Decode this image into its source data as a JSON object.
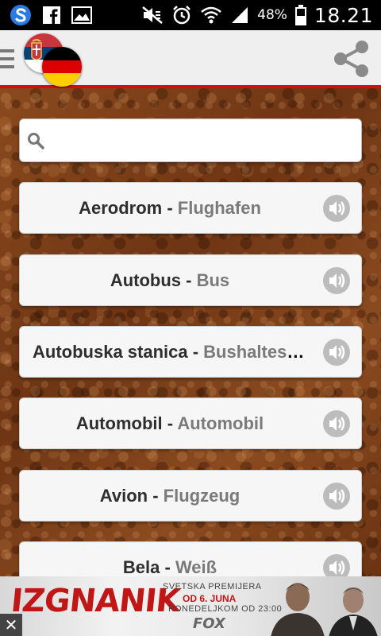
{
  "status_bar": {
    "battery_percent": "48%",
    "time": "18.21",
    "left_icons": [
      "app-s-icon",
      "facebook-icon",
      "gallery-icon"
    ],
    "right_icons": [
      "mute-icon",
      "alarm-icon",
      "wifi-icon",
      "signal-icon",
      "battery-icon"
    ]
  },
  "app_bar": {
    "menu_icon": "hamburger-icon",
    "source_flag": "serbia-flag-icon",
    "target_flag": "germany-flag-icon",
    "share_icon": "share-icon",
    "accent_color": "#d01010"
  },
  "search": {
    "value": "",
    "placeholder": ""
  },
  "words": [
    {
      "sr": "Aerodrom",
      "sep": " - ",
      "de": "Flughafen"
    },
    {
      "sr": "Autobus",
      "sep": " - ",
      "de": "Bus"
    },
    {
      "sr": "Autobuska stanica",
      "sep": " - ",
      "de": "Bushaltestelle"
    },
    {
      "sr": "Automobil",
      "sep": " - ",
      "de": "Automobil"
    },
    {
      "sr": "Avion",
      "sep": " - ",
      "de": "Flugzeug"
    },
    {
      "sr": "Bela",
      "sep": " - ",
      "de": "Weiß"
    }
  ],
  "ad": {
    "title": "IZGNANIK",
    "line1": "SVETSKA PREMIJERA",
    "line2": "OD 6. JUNA",
    "line3": "PONEDELJKOM OD 23:00",
    "channel": "FOX",
    "close_label": "✕"
  }
}
